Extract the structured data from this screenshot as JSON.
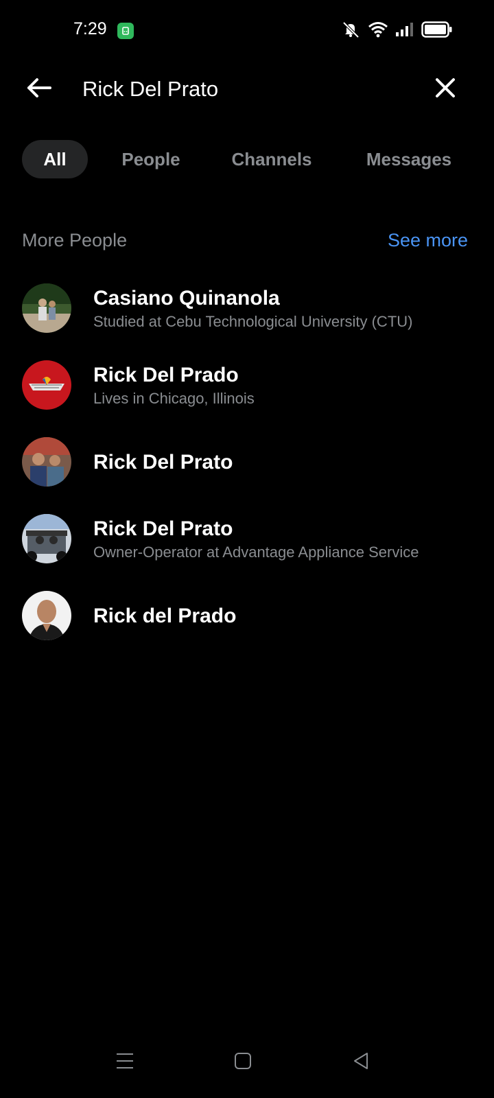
{
  "status_bar": {
    "time": "7:29"
  },
  "search": {
    "query": "Rick Del Prato",
    "back_icon": "arrow-left-icon",
    "clear_icon": "close-icon"
  },
  "filter_tabs": [
    {
      "label": "All",
      "active": true
    },
    {
      "label": "People",
      "active": false
    },
    {
      "label": "Channels",
      "active": false
    },
    {
      "label": "Messages",
      "active": false
    }
  ],
  "section": {
    "title": "More People",
    "see_more": "See more"
  },
  "results": [
    {
      "name": "Casiano Quinanola",
      "subtitle": "Studied at Cebu Technological University (CTU)"
    },
    {
      "name": "Rick Del Prado",
      "subtitle": "Lives in Chicago, Illinois"
    },
    {
      "name": "Rick Del Prato",
      "subtitle": ""
    },
    {
      "name": "Rick Del Prato",
      "subtitle": "Owner-Operator at Advantage Appliance Service"
    },
    {
      "name": "Rick del Prado",
      "subtitle": ""
    }
  ],
  "colors": {
    "background": "#000000",
    "accent": "#4a94f4",
    "secondary_text": "#8a8d91",
    "active_tab_bg": "#242526"
  }
}
